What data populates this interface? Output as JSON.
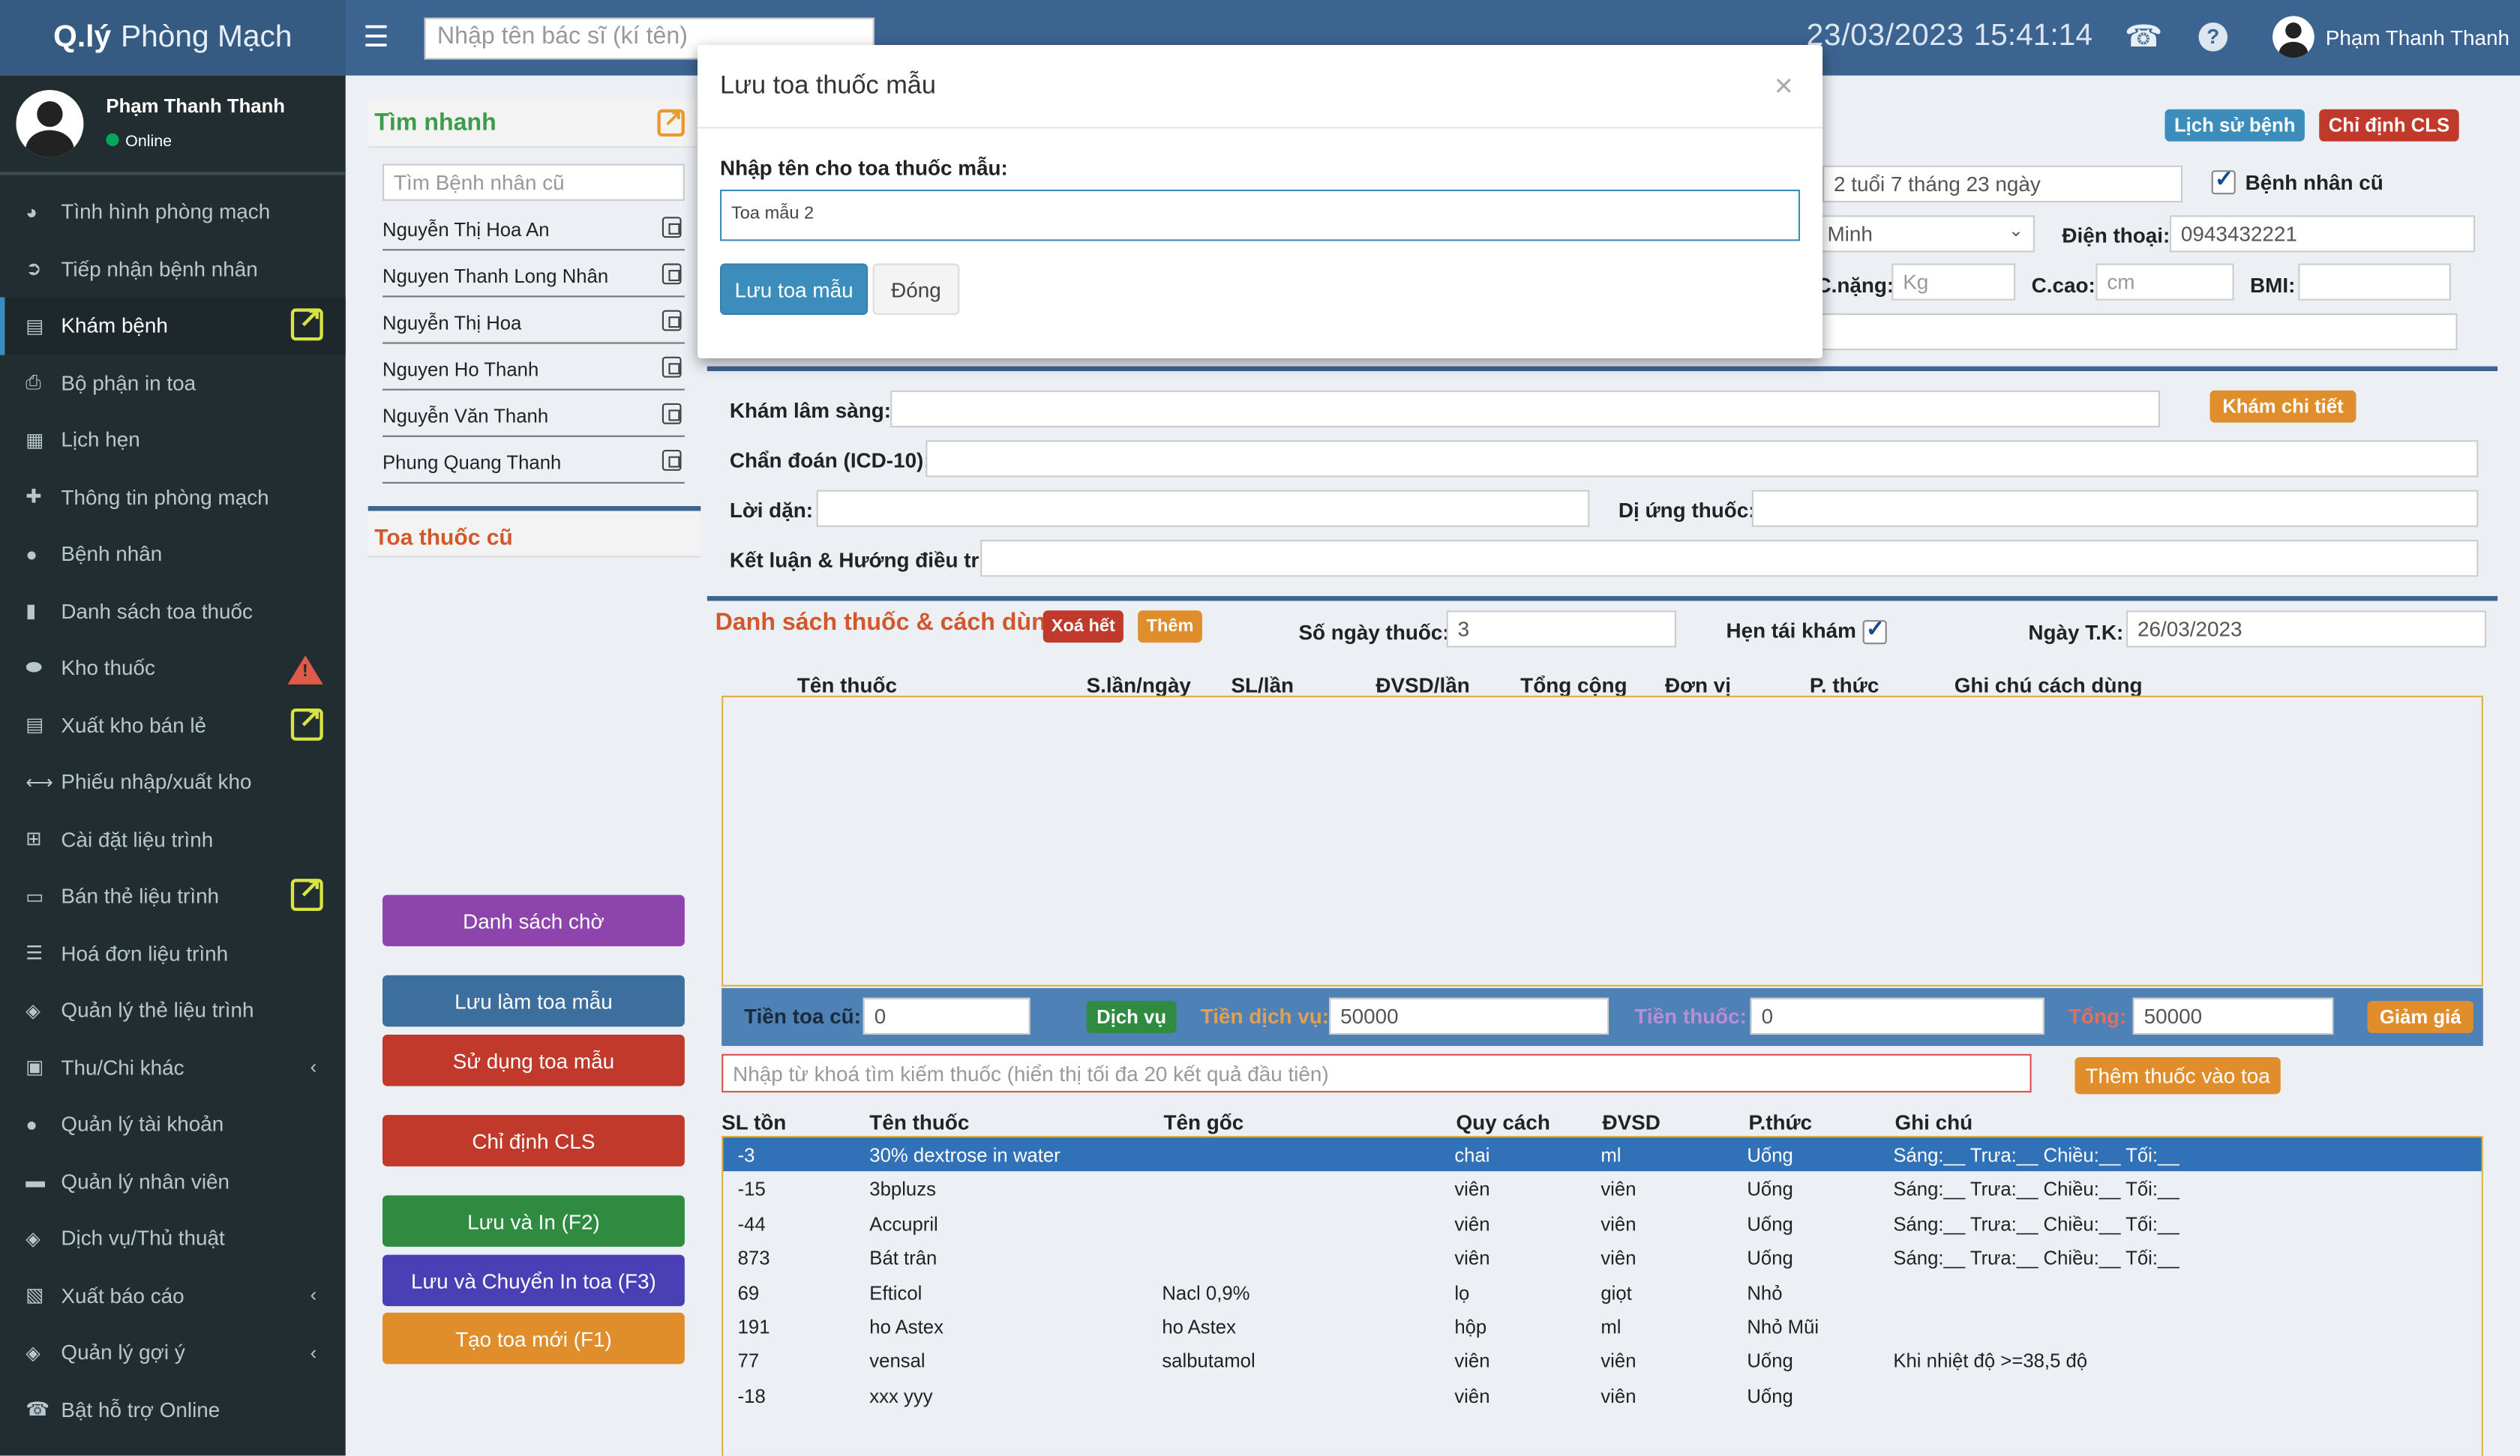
{
  "header": {
    "logo_bold": "Q.lý",
    "logo_light": "Phòng Mạch",
    "doctor_search_placeholder": "Nhập tên bác sĩ (kí tên)",
    "date": "23/03/2023",
    "time": "15:41:14",
    "user_name": "Phạm Thanh Thanh"
  },
  "sidebar": {
    "user_name": "Phạm Thanh Thanh",
    "status": "Online",
    "items": [
      {
        "label": "Tình hình phòng mạch",
        "icon": "dashboard-icon"
      },
      {
        "label": "Tiếp nhận bệnh nhân",
        "icon": "receive-icon"
      },
      {
        "label": "Khám bệnh",
        "icon": "clipboard-icon"
      },
      {
        "label": "Bộ phận in toa",
        "icon": "print-icon"
      },
      {
        "label": "Lịch hẹn",
        "icon": "calendar-icon"
      },
      {
        "label": "Thông tin phòng mạch",
        "icon": "plus-icon"
      },
      {
        "label": "Bệnh nhân",
        "icon": "user-icon"
      },
      {
        "label": "Danh sách toa thuốc",
        "icon": "file-icon"
      },
      {
        "label": "Kho thuốc",
        "icon": "pills-icon"
      },
      {
        "label": "Xuất kho bán lẻ",
        "icon": "clipboard-icon"
      },
      {
        "label": "Phiếu nhập/xuất kho",
        "icon": "arrows-icon"
      },
      {
        "label": "Cài đặt liệu trình",
        "icon": "grid-icon"
      },
      {
        "label": "Bán thẻ liệu trình",
        "icon": "card-icon"
      },
      {
        "label": "Hoá đơn liệu trình",
        "icon": "list-icon"
      },
      {
        "label": "Quản lý thẻ liệu trình",
        "icon": "tag-icon"
      },
      {
        "label": "Thu/Chi khác",
        "icon": "money-icon"
      },
      {
        "label": "Quản lý tài khoản",
        "icon": "users-icon"
      },
      {
        "label": "Quản lý nhân viên",
        "icon": "briefcase-icon"
      },
      {
        "label": "Dịch vụ/Thủ thuật",
        "icon": "tag-icon"
      },
      {
        "label": "Xuất báo cáo",
        "icon": "report-icon"
      },
      {
        "label": "Quản lý gợi ý",
        "icon": "tag-icon"
      },
      {
        "label": "Bật hỗ trợ Online",
        "icon": "phone-icon"
      }
    ]
  },
  "quick": {
    "title": "Tìm nhanh",
    "search_placeholder": "Tìm Bệnh nhân cũ",
    "patients": [
      "Nguyễn Thị Hoa An",
      "Nguyen Thanh Long Nhân",
      "Nguyễn Thị Hoa",
      "Nguyen Ho Thanh",
      "Nguyễn Văn Thanh",
      "Phung Quang Thanh"
    ],
    "old_rx_title": "Toa thuốc cũ"
  },
  "left_buttons": {
    "waiting": "Danh sách chờ",
    "save_template": "Lưu làm toa mẫu",
    "use_template": "Sử dụng toa mẫu",
    "cls": "Chỉ định CLS",
    "save_print": "Lưu và In (F2)",
    "save_transfer": "Lưu và Chuyển In toa (F3)",
    "new_rx": "Tạo toa mới (F1)"
  },
  "patient": {
    "history_btn": "Lịch sử bệnh",
    "cls_btn": "Chỉ định CLS",
    "age": "2 tuổi 7 tháng 23 ngày",
    "old_patient_label": "Bệnh nhân cũ",
    "city": "Minh",
    "phone_label": "Điện thoại:",
    "phone": "0943432221",
    "weight_label": "C.nặng:",
    "weight_placeholder": "Kg",
    "height_label": "C.cao:",
    "height_placeholder": "cm",
    "bmi_label": "BMI:"
  },
  "exam": {
    "clinical_label": "Khám lâm sàng:",
    "detail_btn": "Khám chi tiết",
    "diagnosis_label": "Chẩn đoán (ICD-10):",
    "advice_label": "Lời dặn:",
    "allergy_label": "Dị ứng thuốc:",
    "conclusion_label": "Kết luận & Hướng điều trị:"
  },
  "drugs": {
    "title": "Danh sách thuốc & cách dùng",
    "clear_btn": "Xoá hết",
    "add_btn": "Thêm",
    "days_label": "Số ngày thuốc:",
    "days": "3",
    "revisit_label": "Hẹn tái khám",
    "revisit_date_label": "Ngày T.K:",
    "revisit_date": "26/03/2023",
    "columns": [
      "Tên thuốc",
      "S.lần/ngày",
      "SL/lần",
      "ĐVSD/lần",
      "Tổng cộng",
      "Đơn vị",
      "P. thức",
      "Ghi chú cách dùng"
    ],
    "old_fee_label": "Tiền toa cũ:",
    "old_fee": "0",
    "service_btn": "Dịch vụ",
    "service_fee_label": "Tiền dịch vụ:",
    "service_fee": "50000",
    "drug_fee_label": "Tiền thuốc:",
    "drug_fee": "0",
    "total_label": "Tổng:",
    "total": "50000",
    "discount_btn": "Giảm giá",
    "search_placeholder": "Nhập từ khoá tìm kiếm thuốc (hiển thị tối đa 20 kết quả đầu tiên)",
    "add_to_rx_btn": "Thêm thuốc vào toa"
  },
  "stock": {
    "columns": [
      "SL tồn",
      "Tên thuốc",
      "Tên gốc",
      "Quy cách",
      "ĐVSD",
      "P.thức",
      "Ghi chú"
    ],
    "rows": [
      [
        "-3",
        "30% dextrose in water",
        "",
        "chai",
        "ml",
        "Uống",
        "Sáng:__ Trưa:__ Chiều:__ Tối:__"
      ],
      [
        "-15",
        "3bpluzs",
        "",
        "viên",
        "viên",
        "Uống",
        "Sáng:__ Trưa:__ Chiều:__ Tối:__"
      ],
      [
        "-44",
        "Accupril",
        "",
        "viên",
        "viên",
        "Uống",
        "Sáng:__ Trưa:__ Chiều:__ Tối:__"
      ],
      [
        "873",
        "Bát trân",
        "",
        "viên",
        "viên",
        "Uống",
        "Sáng:__ Trưa:__ Chiều:__ Tối:__"
      ],
      [
        "69",
        "Efticol",
        "Nacl 0,9%",
        "lọ",
        "giọt",
        "Nhỏ",
        ""
      ],
      [
        "191",
        "ho Astex",
        "ho Astex",
        "hộp",
        "ml",
        "Nhỏ Mũi",
        ""
      ],
      [
        "77",
        "vensal",
        "salbutamol",
        "viên",
        "viên",
        "Uống",
        "Khi nhiệt độ >=38,5 độ"
      ],
      [
        "-18",
        "xxx yyy",
        "",
        "viên",
        "viên",
        "Uống",
        ""
      ]
    ]
  },
  "modal": {
    "title": "Lưu toa thuốc mẫu",
    "close": "×",
    "label": "Nhập tên cho toa thuốc mẫu:",
    "value": "Toa mẫu 2",
    "save_btn": "Lưu toa mẫu",
    "close_btn": "Đóng"
  },
  "colors": {
    "header": "#3c6491",
    "sidebar": "#222d32",
    "primary": "#3c8dbc",
    "danger": "#c0392b",
    "warning": "#e08e2b",
    "success": "#3d9b4a"
  }
}
